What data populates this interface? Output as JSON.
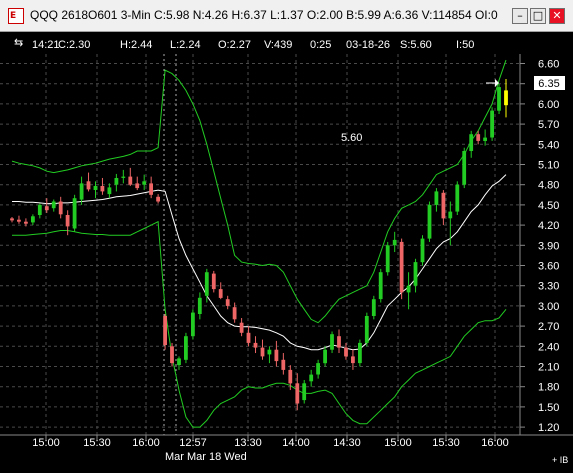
{
  "window": {
    "title": "QQQ 2618O601 3-Min  C:5.98 N:4.26 H:6.37 L:1.37 O:2.00 B:5.99 A:6.36 V:114854 OI:0",
    "icon_label": "E",
    "buttons": {
      "minimize": "–",
      "maximize": "□",
      "close": "✕"
    }
  },
  "info_bar": {
    "time": "14:21",
    "close": "C:2.30",
    "high": "H:2.44",
    "low": "L:2.24",
    "open": "O:2.27",
    "volume": "V:439",
    "countdown": "0:25",
    "date": "03-18-26",
    "study": "S:5.60",
    "interval": "I:50"
  },
  "colors": {
    "background": "#000000",
    "up_candle": "#22cc22",
    "down_candle": "#ee6666",
    "band": "#22cc22",
    "average": "#ffffff",
    "grid": "#4a4a4a",
    "text": "#ffffff",
    "price_tag": "#ffffff",
    "last_bar": "#ffff00"
  },
  "price_axis": {
    "labels": [
      "6.60",
      "6.30",
      "6.00",
      "5.70",
      "5.40",
      "5.10",
      "4.80",
      "4.50",
      "4.20",
      "3.90",
      "3.60",
      "3.30",
      "3.00",
      "2.70",
      "2.40",
      "2.10",
      "1.80",
      "1.50",
      "1.20"
    ],
    "current_price": "6.35"
  },
  "time_axis": {
    "labels": [
      "15:00",
      "15:30",
      "16:00",
      "12:57",
      "13:30",
      "14:00",
      "14:30",
      "15:00",
      "15:30",
      "16:00"
    ],
    "date_label": "Mar Mar 18 Wed",
    "corner": "+ IB"
  },
  "annotation": "5.60",
  "chart_data": {
    "type": "candlestick",
    "ylim": [
      1.2,
      6.65
    ],
    "grid": true,
    "candles": [
      [
        4.3,
        4.32,
        4.24,
        4.27
      ],
      [
        4.28,
        4.34,
        4.22,
        4.25
      ],
      [
        4.25,
        4.3,
        4.18,
        4.22
      ],
      [
        4.24,
        4.36,
        4.2,
        4.33
      ],
      [
        4.35,
        4.52,
        4.3,
        4.5
      ],
      [
        4.48,
        4.6,
        4.38,
        4.42
      ],
      [
        4.45,
        4.58,
        4.4,
        4.55
      ],
      [
        4.55,
        4.62,
        4.3,
        4.36
      ],
      [
        4.35,
        4.42,
        4.05,
        4.18
      ],
      [
        4.15,
        4.65,
        4.1,
        4.6
      ],
      [
        4.58,
        4.92,
        4.5,
        4.82
      ],
      [
        4.85,
        4.98,
        4.7,
        4.73
      ],
      [
        4.72,
        4.85,
        4.6,
        4.78
      ],
      [
        4.78,
        4.9,
        4.65,
        4.7
      ],
      [
        4.66,
        4.82,
        4.6,
        4.76
      ],
      [
        4.8,
        4.96,
        4.7,
        4.9
      ],
      [
        4.9,
        5.02,
        4.82,
        4.92
      ],
      [
        4.92,
        5.05,
        4.78,
        4.8
      ],
      [
        4.82,
        4.92,
        4.72,
        4.75
      ],
      [
        4.8,
        4.95,
        4.72,
        4.85
      ],
      [
        4.82,
        4.92,
        4.6,
        4.65
      ],
      [
        4.62,
        4.66,
        4.52,
        4.55
      ],
      [
        2.85,
        2.88,
        2.35,
        2.42
      ],
      [
        2.4,
        2.45,
        2.1,
        2.15
      ],
      [
        2.12,
        2.25,
        2.05,
        2.22
      ],
      [
        2.2,
        2.6,
        2.15,
        2.55
      ],
      [
        2.55,
        2.95,
        2.5,
        2.9
      ],
      [
        2.88,
        3.2,
        2.8,
        3.12
      ],
      [
        3.15,
        3.55,
        3.05,
        3.5
      ],
      [
        3.48,
        3.52,
        3.2,
        3.25
      ],
      [
        3.25,
        3.35,
        3.1,
        3.12
      ],
      [
        3.1,
        3.15,
        2.95,
        3.0
      ],
      [
        2.98,
        3.05,
        2.75,
        2.8
      ],
      [
        2.75,
        2.82,
        2.55,
        2.6
      ],
      [
        2.6,
        2.7,
        2.4,
        2.45
      ],
      [
        2.45,
        2.55,
        2.3,
        2.38
      ],
      [
        2.38,
        2.5,
        2.2,
        2.25
      ],
      [
        2.28,
        2.4,
        2.15,
        2.35
      ],
      [
        2.35,
        2.48,
        2.1,
        2.18
      ],
      [
        2.2,
        2.3,
        1.98,
        2.05
      ],
      [
        2.05,
        2.12,
        1.75,
        1.85
      ],
      [
        1.85,
        2.0,
        1.45,
        1.55
      ],
      [
        1.6,
        1.9,
        1.55,
        1.85
      ],
      [
        1.88,
        2.05,
        1.8,
        1.98
      ],
      [
        1.98,
        2.2,
        1.92,
        2.15
      ],
      [
        2.15,
        2.4,
        2.1,
        2.35
      ],
      [
        2.35,
        2.62,
        2.3,
        2.58
      ],
      [
        2.55,
        2.65,
        2.3,
        2.38
      ],
      [
        2.38,
        2.45,
        2.2,
        2.25
      ],
      [
        2.25,
        2.35,
        2.05,
        2.15
      ],
      [
        2.15,
        2.5,
        2.1,
        2.45
      ],
      [
        2.45,
        2.9,
        2.4,
        2.85
      ],
      [
        2.85,
        3.15,
        2.8,
        3.1
      ],
      [
        3.1,
        3.55,
        3.05,
        3.5
      ],
      [
        3.5,
        3.95,
        3.45,
        3.9
      ],
      [
        3.9,
        4.1,
        3.8,
        3.98
      ],
      [
        3.95,
        4.0,
        3.1,
        3.2
      ],
      [
        3.2,
        3.5,
        2.95,
        3.3
      ],
      [
        3.3,
        3.7,
        3.2,
        3.65
      ],
      [
        3.65,
        4.05,
        3.6,
        4.0
      ],
      [
        4.0,
        4.55,
        3.95,
        4.5
      ],
      [
        4.5,
        4.75,
        4.4,
        4.7
      ],
      [
        4.68,
        4.72,
        4.2,
        4.3
      ],
      [
        4.3,
        4.55,
        3.9,
        4.4
      ],
      [
        4.4,
        4.85,
        4.35,
        4.8
      ],
      [
        4.8,
        5.35,
        4.75,
        5.3
      ],
      [
        5.3,
        5.6,
        5.2,
        5.55
      ],
      [
        5.55,
        5.6,
        5.4,
        5.45
      ],
      [
        5.45,
        5.62,
        5.38,
        5.5
      ],
      [
        5.5,
        5.95,
        5.45,
        5.9
      ],
      [
        5.9,
        6.3,
        5.85,
        6.25
      ],
      [
        6.2,
        6.37,
        5.8,
        5.98
      ]
    ],
    "band_upper": [
      5.15,
      5.12,
      5.1,
      5.08,
      5.05,
      5.0,
      4.98,
      5.0,
      5.02,
      5.05,
      5.08,
      5.1,
      5.12,
      5.15,
      5.18,
      5.2,
      5.22,
      5.25,
      5.3,
      5.3,
      5.3,
      5.35,
      6.5,
      6.45,
      6.35,
      6.2,
      6.0,
      5.75,
      5.4,
      5.0,
      4.6,
      4.2,
      3.75,
      3.65,
      3.63,
      3.62,
      3.6,
      3.62,
      3.6,
      3.5,
      3.3,
      3.1,
      2.95,
      2.8,
      2.75,
      2.85,
      2.98,
      3.1,
      3.15,
      3.2,
      3.25,
      3.3,
      3.5,
      3.8,
      4.1,
      4.3,
      4.45,
      4.5,
      4.55,
      4.65,
      4.8,
      4.95,
      5.0,
      5.05,
      5.1,
      5.25,
      5.45,
      5.6,
      5.8,
      6.0,
      6.35,
      6.65
    ],
    "band_lower": [
      4.05,
      4.05,
      4.05,
      4.06,
      4.07,
      4.08,
      4.1,
      4.12,
      4.12,
      4.1,
      4.08,
      4.07,
      4.06,
      4.06,
      4.05,
      4.05,
      4.05,
      4.05,
      4.1,
      4.15,
      4.2,
      4.25,
      2.95,
      2.25,
      1.75,
      1.35,
      1.2,
      1.2,
      1.3,
      1.45,
      1.55,
      1.6,
      1.65,
      1.75,
      1.8,
      1.78,
      1.78,
      1.82,
      1.85,
      1.85,
      1.82,
      1.75,
      1.7,
      1.7,
      1.73,
      1.75,
      1.7,
      1.55,
      1.4,
      1.3,
      1.25,
      1.25,
      1.35,
      1.45,
      1.55,
      1.65,
      1.8,
      1.9,
      2.0,
      2.05,
      2.1,
      2.15,
      2.2,
      2.25,
      2.4,
      2.55,
      2.65,
      2.75,
      2.78,
      2.78,
      2.82,
      2.95
    ],
    "average": [
      4.55,
      4.55,
      4.54,
      4.54,
      4.53,
      4.52,
      4.52,
      4.53,
      4.53,
      4.54,
      4.55,
      4.56,
      4.57,
      4.58,
      4.6,
      4.62,
      4.63,
      4.64,
      4.66,
      4.68,
      4.7,
      4.72,
      4.7,
      4.35,
      4.0,
      3.75,
      3.55,
      3.35,
      3.15,
      3.0,
      2.85,
      2.75,
      2.7,
      2.69,
      2.69,
      2.68,
      2.66,
      2.64,
      2.6,
      2.55,
      2.45,
      2.4,
      2.38,
      2.35,
      2.35,
      2.38,
      2.42,
      2.4,
      2.37,
      2.35,
      2.36,
      2.45,
      2.6,
      2.8,
      3.0,
      3.1,
      3.2,
      3.28,
      3.4,
      3.55,
      3.7,
      3.85,
      3.95,
      4.0,
      4.1,
      4.25,
      4.4,
      4.5,
      4.65,
      4.78,
      4.85,
      4.95
    ]
  }
}
